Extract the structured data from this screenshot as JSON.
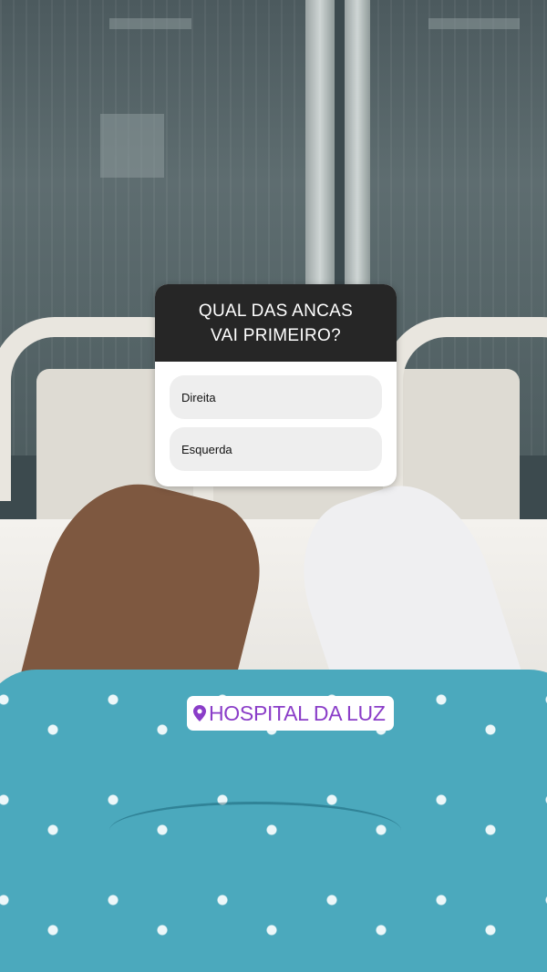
{
  "quiz": {
    "question": "QUAL DAS ANCAS VAI PRIMEIRO?",
    "options": [
      "Direita",
      "Esquerda"
    ]
  },
  "location": {
    "label": "HOSPITAL DA LUZ",
    "icon": "location-pin-icon",
    "color": "#8a3dc8"
  },
  "colors": {
    "quiz_header": "#262626",
    "option_bg": "#eeeeee",
    "gown": "#4ba9bd"
  }
}
